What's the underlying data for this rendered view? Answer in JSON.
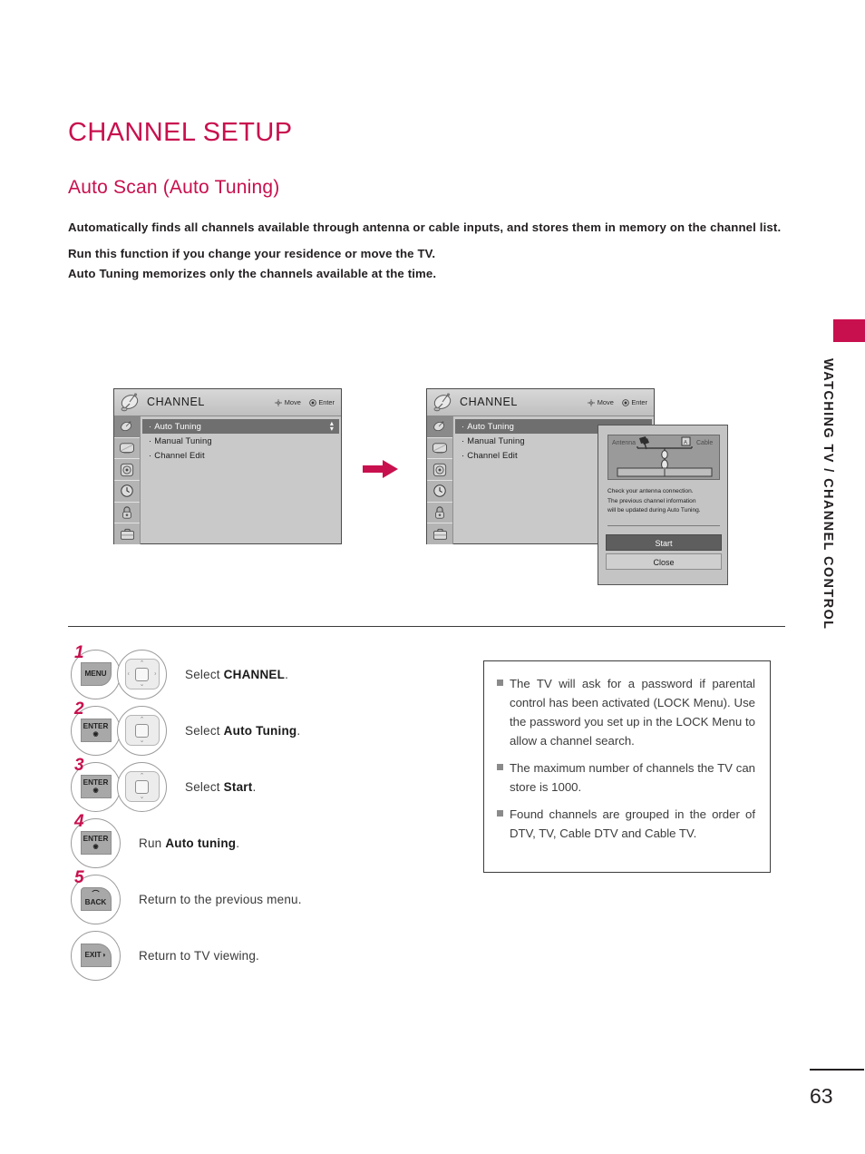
{
  "page": {
    "title": "CHANNEL SETUP",
    "subtitle": "Auto Scan (Auto Tuning)",
    "intro_line1": "Automatically finds all channels available through antenna or cable inputs, and stores them in memory on the channel list.",
    "intro_line2": "Run this function if you change your residence or move the TV.",
    "intro_line3": "Auto Tuning memorizes only the channels available at the time.",
    "side_tab_label": "WATCHING TV / CHANNEL CONTROL",
    "page_number": "63",
    "accent_color": "#C8104E"
  },
  "osd": {
    "title": "CHANNEL",
    "hint_move": "Move",
    "hint_enter": "Enter",
    "menu_items": [
      {
        "label": "Auto Tuning",
        "selected": true
      },
      {
        "label": "Manual Tuning",
        "selected": false
      },
      {
        "label": "Channel Edit",
        "selected": false
      }
    ],
    "rail_icons": [
      "satellite-dish-icon",
      "picture-icon",
      "audio-icon",
      "clock-icon",
      "lock-icon",
      "setup-icon"
    ]
  },
  "dialog": {
    "antenna_label": "Antenna",
    "cable_label": "Cable",
    "message_line1": "Check your antenna connection.",
    "message_line2": "The previous channel information",
    "message_line3": "will be updated during Auto Tuning.",
    "start_label": "Start",
    "close_label": "Close"
  },
  "steps": [
    {
      "number": "1",
      "keys": [
        "MENU"
      ],
      "has_navpad": true,
      "navpad_full": true,
      "text_prefix": "Select ",
      "text_bold": "CHANNEL",
      "text_suffix": "."
    },
    {
      "number": "2",
      "keys": [
        "ENTER"
      ],
      "has_navpad": true,
      "navpad_full": false,
      "text_prefix": "Select ",
      "text_bold": "Auto Tuning",
      "text_suffix": "."
    },
    {
      "number": "3",
      "keys": [
        "ENTER"
      ],
      "has_navpad": true,
      "navpad_full": false,
      "text_prefix": "Select ",
      "text_bold": "Start",
      "text_suffix": "."
    },
    {
      "number": "4",
      "keys": [
        "ENTER"
      ],
      "has_navpad": false,
      "navpad_full": false,
      "text_prefix": "Run ",
      "text_bold": "Auto tuning",
      "text_suffix": "."
    },
    {
      "number": "5",
      "keys": [
        "BACK"
      ],
      "has_navpad": false,
      "navpad_full": false,
      "text_prefix": "Return to the previous menu.",
      "text_bold": "",
      "text_suffix": ""
    },
    {
      "number": "",
      "keys": [
        "EXIT"
      ],
      "has_navpad": false,
      "navpad_full": false,
      "text_prefix": "Return to TV viewing.",
      "text_bold": "",
      "text_suffix": ""
    }
  ],
  "notes": [
    "The TV will ask for a password if parental control has been activated (LOCK Menu). Use the password you set up in the LOCK Menu to allow a channel search.",
    "The maximum number of channels the TV can store is 1000.",
    "Found channels are grouped in the order of DTV, TV, Cable DTV and Cable TV."
  ]
}
